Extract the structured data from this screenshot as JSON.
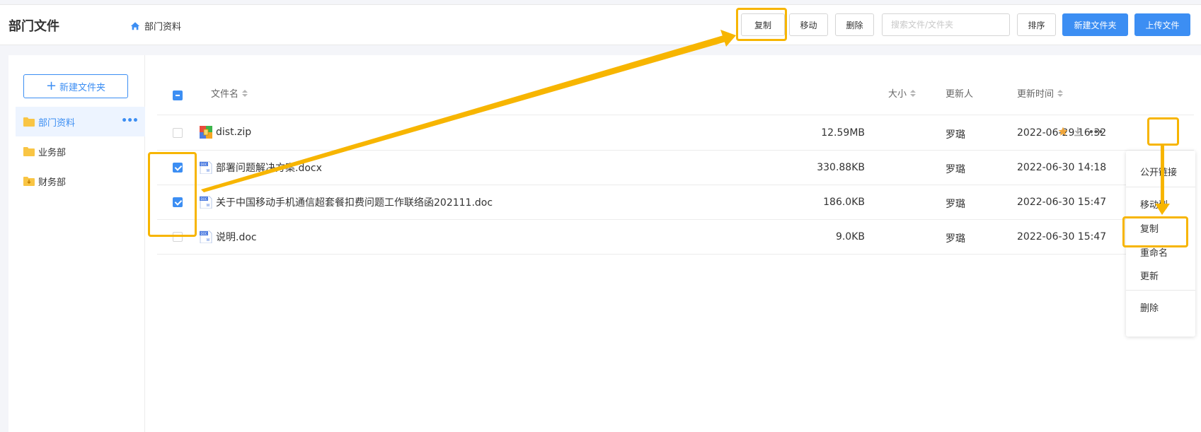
{
  "header": {
    "title": "部门文件",
    "breadcrumb": "部门资料",
    "buttons": {
      "copy": "复制",
      "move": "移动",
      "delete": "删除",
      "sort": "排序",
      "new_folder": "新建文件夹",
      "upload": "上传文件"
    },
    "search_placeholder": "搜索文件/文件夹"
  },
  "sidebar": {
    "new_folder_label": "新建文件夹",
    "items": [
      {
        "label": "部门资料",
        "active": true
      },
      {
        "label": "业务部"
      },
      {
        "label": "财务部"
      }
    ]
  },
  "table": {
    "columns": {
      "name": "文件名",
      "size": "大小",
      "updater": "更新人",
      "updated_at": "更新时间"
    },
    "rows": [
      {
        "name": "dist.zip",
        "size": "12.59MB",
        "updater": "罗璐",
        "updated_at": "2022-06-29 16:32",
        "checked": false,
        "icon": "zip-icon"
      },
      {
        "name": "部署问题解决方案.docx",
        "size": "330.88KB",
        "updater": "罗璐",
        "updated_at": "2022-06-30 14:18",
        "checked": true,
        "icon": "doc-icon"
      },
      {
        "name": "关于中国移动手机通信超套餐扣费问题工作联络函202111.doc",
        "size": "186.0KB",
        "updater": "罗璐",
        "updated_at": "2022-06-30 15:47",
        "checked": true,
        "icon": "doc-icon"
      },
      {
        "name": "说明.doc",
        "size": "9.0KB",
        "updater": "罗璐",
        "updated_at": "2022-06-30 15:47",
        "checked": false,
        "icon": "doc-icon"
      }
    ]
  },
  "context_menu": {
    "items": [
      "公开链接",
      "移动到",
      "复制",
      "重命名",
      "更新",
      "删除"
    ]
  },
  "colors": {
    "primary": "#3c8ef3",
    "highlight": "#f7b500",
    "star": "#f0a63a"
  }
}
